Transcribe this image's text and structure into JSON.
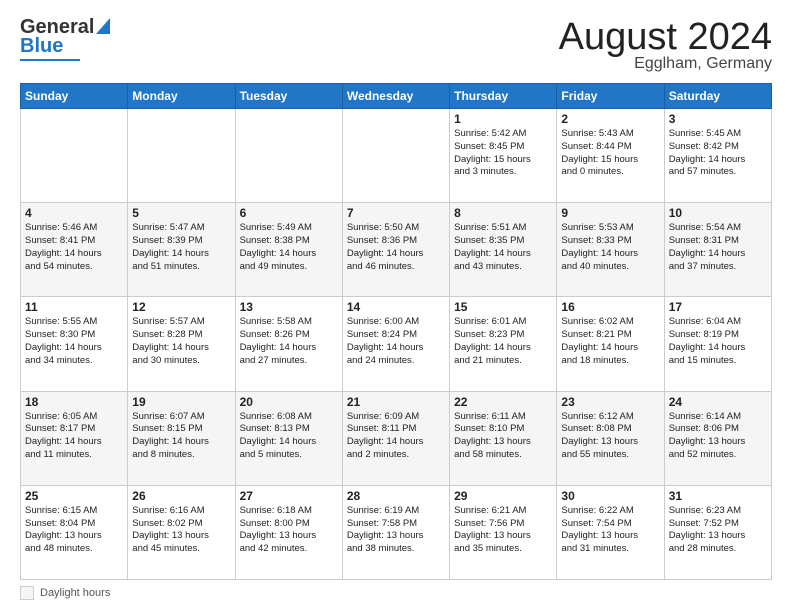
{
  "header": {
    "logo_general": "General",
    "logo_blue": "Blue",
    "month_title": "August 2024",
    "location": "Egglham, Germany"
  },
  "footer": {
    "daylight_label": "Daylight hours"
  },
  "days_of_week": [
    "Sunday",
    "Monday",
    "Tuesday",
    "Wednesday",
    "Thursday",
    "Friday",
    "Saturday"
  ],
  "weeks": [
    [
      {
        "day": "",
        "info": ""
      },
      {
        "day": "",
        "info": ""
      },
      {
        "day": "",
        "info": ""
      },
      {
        "day": "",
        "info": ""
      },
      {
        "day": "1",
        "info": "Sunrise: 5:42 AM\nSunset: 8:45 PM\nDaylight: 15 hours\nand 3 minutes."
      },
      {
        "day": "2",
        "info": "Sunrise: 5:43 AM\nSunset: 8:44 PM\nDaylight: 15 hours\nand 0 minutes."
      },
      {
        "day": "3",
        "info": "Sunrise: 5:45 AM\nSunset: 8:42 PM\nDaylight: 14 hours\nand 57 minutes."
      }
    ],
    [
      {
        "day": "4",
        "info": "Sunrise: 5:46 AM\nSunset: 8:41 PM\nDaylight: 14 hours\nand 54 minutes."
      },
      {
        "day": "5",
        "info": "Sunrise: 5:47 AM\nSunset: 8:39 PM\nDaylight: 14 hours\nand 51 minutes."
      },
      {
        "day": "6",
        "info": "Sunrise: 5:49 AM\nSunset: 8:38 PM\nDaylight: 14 hours\nand 49 minutes."
      },
      {
        "day": "7",
        "info": "Sunrise: 5:50 AM\nSunset: 8:36 PM\nDaylight: 14 hours\nand 46 minutes."
      },
      {
        "day": "8",
        "info": "Sunrise: 5:51 AM\nSunset: 8:35 PM\nDaylight: 14 hours\nand 43 minutes."
      },
      {
        "day": "9",
        "info": "Sunrise: 5:53 AM\nSunset: 8:33 PM\nDaylight: 14 hours\nand 40 minutes."
      },
      {
        "day": "10",
        "info": "Sunrise: 5:54 AM\nSunset: 8:31 PM\nDaylight: 14 hours\nand 37 minutes."
      }
    ],
    [
      {
        "day": "11",
        "info": "Sunrise: 5:55 AM\nSunset: 8:30 PM\nDaylight: 14 hours\nand 34 minutes."
      },
      {
        "day": "12",
        "info": "Sunrise: 5:57 AM\nSunset: 8:28 PM\nDaylight: 14 hours\nand 30 minutes."
      },
      {
        "day": "13",
        "info": "Sunrise: 5:58 AM\nSunset: 8:26 PM\nDaylight: 14 hours\nand 27 minutes."
      },
      {
        "day": "14",
        "info": "Sunrise: 6:00 AM\nSunset: 8:24 PM\nDaylight: 14 hours\nand 24 minutes."
      },
      {
        "day": "15",
        "info": "Sunrise: 6:01 AM\nSunset: 8:23 PM\nDaylight: 14 hours\nand 21 minutes."
      },
      {
        "day": "16",
        "info": "Sunrise: 6:02 AM\nSunset: 8:21 PM\nDaylight: 14 hours\nand 18 minutes."
      },
      {
        "day": "17",
        "info": "Sunrise: 6:04 AM\nSunset: 8:19 PM\nDaylight: 14 hours\nand 15 minutes."
      }
    ],
    [
      {
        "day": "18",
        "info": "Sunrise: 6:05 AM\nSunset: 8:17 PM\nDaylight: 14 hours\nand 11 minutes."
      },
      {
        "day": "19",
        "info": "Sunrise: 6:07 AM\nSunset: 8:15 PM\nDaylight: 14 hours\nand 8 minutes."
      },
      {
        "day": "20",
        "info": "Sunrise: 6:08 AM\nSunset: 8:13 PM\nDaylight: 14 hours\nand 5 minutes."
      },
      {
        "day": "21",
        "info": "Sunrise: 6:09 AM\nSunset: 8:11 PM\nDaylight: 14 hours\nand 2 minutes."
      },
      {
        "day": "22",
        "info": "Sunrise: 6:11 AM\nSunset: 8:10 PM\nDaylight: 13 hours\nand 58 minutes."
      },
      {
        "day": "23",
        "info": "Sunrise: 6:12 AM\nSunset: 8:08 PM\nDaylight: 13 hours\nand 55 minutes."
      },
      {
        "day": "24",
        "info": "Sunrise: 6:14 AM\nSunset: 8:06 PM\nDaylight: 13 hours\nand 52 minutes."
      }
    ],
    [
      {
        "day": "25",
        "info": "Sunrise: 6:15 AM\nSunset: 8:04 PM\nDaylight: 13 hours\nand 48 minutes."
      },
      {
        "day": "26",
        "info": "Sunrise: 6:16 AM\nSunset: 8:02 PM\nDaylight: 13 hours\nand 45 minutes."
      },
      {
        "day": "27",
        "info": "Sunrise: 6:18 AM\nSunset: 8:00 PM\nDaylight: 13 hours\nand 42 minutes."
      },
      {
        "day": "28",
        "info": "Sunrise: 6:19 AM\nSunset: 7:58 PM\nDaylight: 13 hours\nand 38 minutes."
      },
      {
        "day": "29",
        "info": "Sunrise: 6:21 AM\nSunset: 7:56 PM\nDaylight: 13 hours\nand 35 minutes."
      },
      {
        "day": "30",
        "info": "Sunrise: 6:22 AM\nSunset: 7:54 PM\nDaylight: 13 hours\nand 31 minutes."
      },
      {
        "day": "31",
        "info": "Sunrise: 6:23 AM\nSunset: 7:52 PM\nDaylight: 13 hours\nand 28 minutes."
      }
    ]
  ]
}
